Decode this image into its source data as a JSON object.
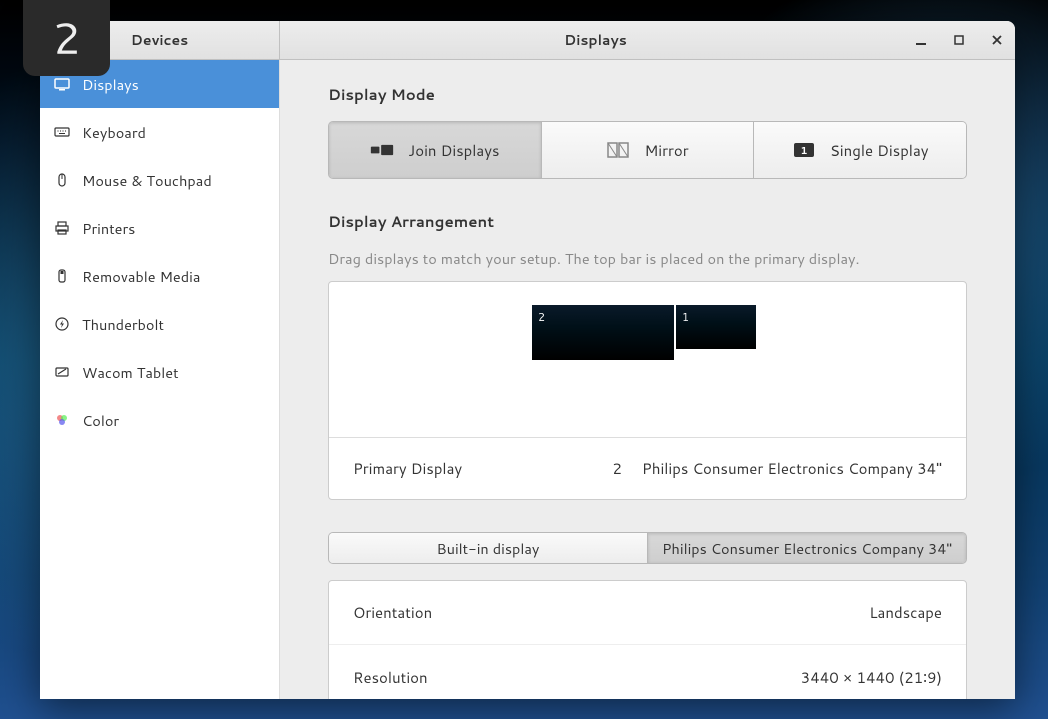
{
  "workspace_number": "2",
  "titlebar": {
    "back_label": "Devices",
    "title": "Displays"
  },
  "sidebar": {
    "items": [
      {
        "label": "Displays",
        "icon": "displays-icon",
        "selected": true
      },
      {
        "label": "Keyboard",
        "icon": "keyboard-icon",
        "selected": false
      },
      {
        "label": "Mouse & Touchpad",
        "icon": "mouse-icon",
        "selected": false
      },
      {
        "label": "Printers",
        "icon": "printer-icon",
        "selected": false
      },
      {
        "label": "Removable Media",
        "icon": "media-icon",
        "selected": false
      },
      {
        "label": "Thunderbolt",
        "icon": "thunderbolt-icon",
        "selected": false
      },
      {
        "label": "Wacom Tablet",
        "icon": "tablet-icon",
        "selected": false
      },
      {
        "label": "Color",
        "icon": "color-icon",
        "selected": false
      }
    ]
  },
  "display_mode": {
    "title": "Display Mode",
    "options": [
      {
        "label": "Join Displays",
        "active": true
      },
      {
        "label": "Mirror",
        "active": false
      },
      {
        "label": "Single Display",
        "active": false
      }
    ]
  },
  "arrangement": {
    "title": "Display Arrangement",
    "hint": "Drag displays to match your setup. The top bar is placed on the primary display.",
    "displays": [
      {
        "number": "2",
        "primary": true
      },
      {
        "number": "1",
        "primary": false
      }
    ],
    "primary_row": {
      "label": "Primary Display",
      "number": "2",
      "name": "Philips Consumer Electronics Company 34\""
    }
  },
  "display_tabs": [
    {
      "label": "Built-in display",
      "active": false
    },
    {
      "label": "Philips Consumer Electronics Company 34\"",
      "active": true
    }
  ],
  "settings": [
    {
      "label": "Orientation",
      "value": "Landscape"
    },
    {
      "label": "Resolution",
      "value": "3440 × 1440 (21∶9)"
    }
  ]
}
